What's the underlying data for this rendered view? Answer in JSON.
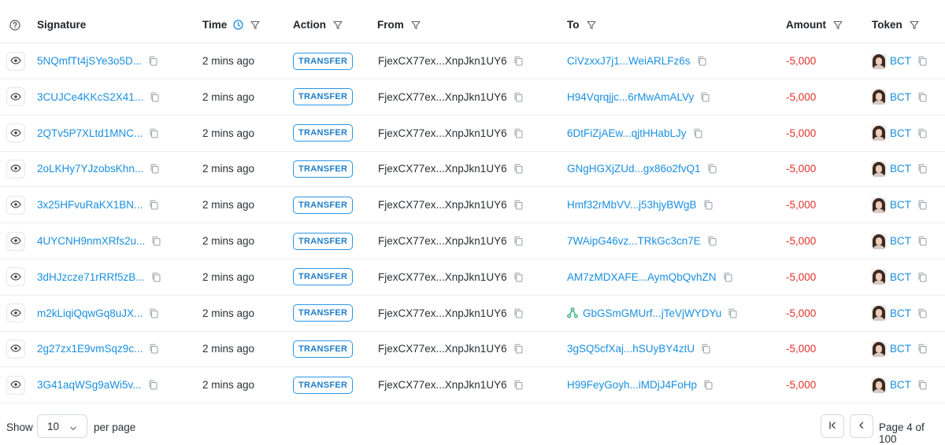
{
  "columns": {
    "signature": "Signature",
    "time": "Time",
    "action": "Action",
    "from": "From",
    "to": "To",
    "amount": "Amount",
    "token": "Token"
  },
  "rows": [
    {
      "signature": "5NQmfTt4jSYe3o5D...",
      "time": "2 mins ago",
      "action": "TRANSFER",
      "from": "FjexCX77ex...XnpJkn1UY6",
      "to": "CiVzxxJ7j1...WeiARLFz6s",
      "amount": "-5,000",
      "token": "BCT"
    },
    {
      "signature": "3CUJCe4KKcS2X41...",
      "time": "2 mins ago",
      "action": "TRANSFER",
      "from": "FjexCX77ex...XnpJkn1UY6",
      "to": "H94Vqrqjjc...6rMwAmALVy",
      "amount": "-5,000",
      "token": "BCT"
    },
    {
      "signature": "2QTv5P7XLtd1MNC...",
      "time": "2 mins ago",
      "action": "TRANSFER",
      "from": "FjexCX77ex...XnpJkn1UY6",
      "to": "6DtFiZjAEw...qjtHHabLJy",
      "amount": "-5,000",
      "token": "BCT"
    },
    {
      "signature": "2oLKHy7YJzobsKhn...",
      "time": "2 mins ago",
      "action": "TRANSFER",
      "from": "FjexCX77ex...XnpJkn1UY6",
      "to": "GNgHGXjZUd...gx86o2fvQ1",
      "amount": "-5,000",
      "token": "BCT"
    },
    {
      "signature": "3x25HFvuRaKX1BN...",
      "time": "2 mins ago",
      "action": "TRANSFER",
      "from": "FjexCX77ex...XnpJkn1UY6",
      "to": "Hmf32rMbVV...j53hjyBWgB",
      "amount": "-5,000",
      "token": "BCT"
    },
    {
      "signature": "4UYCNH9nmXRfs2u...",
      "time": "2 mins ago",
      "action": "TRANSFER",
      "from": "FjexCX77ex...XnpJkn1UY6",
      "to": "7WAipG46vz...TRkGc3cn7E",
      "amount": "-5,000",
      "token": "BCT"
    },
    {
      "signature": "3dHJzcze71rRRf5zB...",
      "time": "2 mins ago",
      "action": "TRANSFER",
      "from": "FjexCX77ex...XnpJkn1UY6",
      "to": "AM7zMDXAFE...AymQbQvhZN",
      "amount": "-5,000",
      "token": "BCT"
    },
    {
      "signature": "m2kLiqiQqwGq8uJX...",
      "time": "2 mins ago",
      "action": "TRANSFER",
      "from": "FjexCX77ex...XnpJkn1UY6",
      "to": "GbGSmGMUrf...jTeVjWYDYu",
      "to_icon": "network-icon",
      "amount": "-5,000",
      "token": "BCT"
    },
    {
      "signature": "2g27zx1E9vmSqz9c...",
      "time": "2 mins ago",
      "action": "TRANSFER",
      "from": "FjexCX77ex...XnpJkn1UY6",
      "to": "3gSQ5cfXaj...hSUyBY4ztU",
      "amount": "-5,000",
      "token": "BCT"
    },
    {
      "signature": "3G41aqWSg9aWi5v...",
      "time": "2 mins ago",
      "action": "TRANSFER",
      "from": "FjexCX77ex...XnpJkn1UY6",
      "to": "H99FeyGoyh...iMDjJ4FoHp",
      "amount": "-5,000",
      "token": "BCT"
    }
  ],
  "footer": {
    "show_label": "Show",
    "per_page_value": "10",
    "per_page_label": "per page",
    "page_info": "Page 4 of 100"
  },
  "colors": {
    "link": "#1a8fe0",
    "amount_negative": "#e1302a",
    "badge_border": "#2a96e6"
  },
  "icons": {
    "help": "help-circle-icon",
    "filter": "filter-icon",
    "clock": "clock-icon",
    "eye": "eye-icon",
    "copy": "copy-icon",
    "first_page": "first-page-icon",
    "prev_page": "chevron-left-icon",
    "dropdown": "chevron-down-icon"
  }
}
